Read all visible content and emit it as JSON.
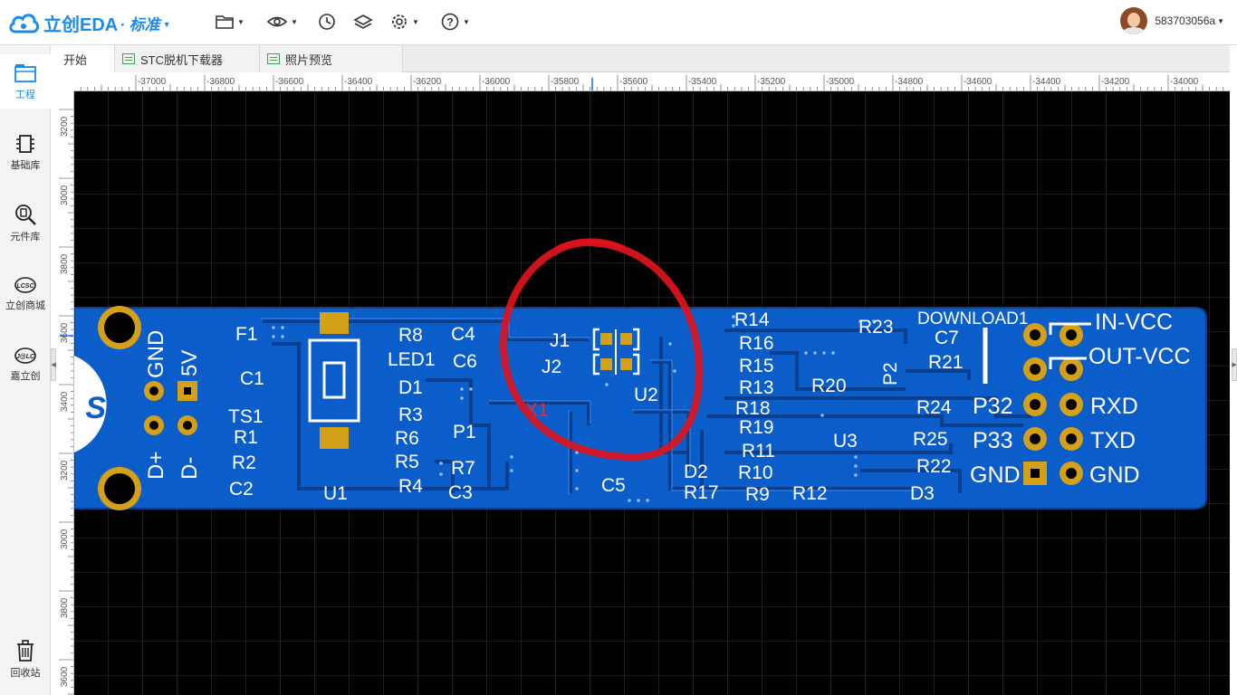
{
  "app": {
    "logo_text": "立创EDA",
    "edition": "标准"
  },
  "user": {
    "name": "583703056a"
  },
  "toolbar": {
    "items": [
      "folder-icon",
      "eye-icon",
      "history-icon",
      "layers-icon",
      "gear-icon",
      "help-icon"
    ]
  },
  "sidebar": {
    "items": [
      {
        "label": "工程",
        "icon": "project-icon",
        "active": true
      },
      {
        "label": "基础库",
        "icon": "chip-icon"
      },
      {
        "label": "元件库",
        "icon": "component-search-icon"
      },
      {
        "label": "立创商城",
        "icon": "lcsc-icon"
      },
      {
        "label": "嘉立创",
        "icon": "jlc-icon"
      },
      {
        "label": "回收站",
        "icon": "trash-icon"
      }
    ]
  },
  "tabs": [
    {
      "label": "开始"
    },
    {
      "label": "STC脱机下载器"
    },
    {
      "label": "照片预览"
    }
  ],
  "ruler": {
    "top_labels": [
      "-37000",
      "-36800",
      "-36600",
      "-36400",
      "-36200",
      "-36000",
      "-35800",
      "-35600",
      "-35400",
      "-35200",
      "-35000",
      "-34800",
      "-34600",
      "-34400",
      "-34200",
      "-34000"
    ],
    "left_labels": [
      "3200",
      "3000",
      "3800",
      "3600",
      "3400",
      "3200",
      "3000",
      "3800",
      "3600"
    ]
  },
  "pcb": {
    "logo_text": "SC",
    "left_pin_labels": [
      "GND",
      "5V",
      "D+",
      "D-"
    ],
    "designators": {
      "F1": "F1",
      "C1": "C1",
      "TS1": "TS1",
      "R1": "R1",
      "R2": "R2",
      "C2": "C2",
      "U1": "U1",
      "R8": "R8",
      "C4": "C4",
      "LED1": "LED1",
      "C6": "C6",
      "D1": "D1",
      "R3": "R3",
      "R6": "R6",
      "P1": "P1",
      "R5": "R5",
      "R7": "R7",
      "R4": "R4",
      "C3": "C3",
      "J1": "J1",
      "J2": "J2",
      "X1": "X1",
      "U2": "U2",
      "C5": "C5",
      "R14": "R14",
      "R16": "R16",
      "R15": "R15",
      "R13": "R13",
      "R18": "R18",
      "R19": "R19",
      "R11": "R11",
      "R10": "R10",
      "D2": "D2",
      "R17": "R17",
      "R9": "R9",
      "R12": "R12",
      "R20": "R20",
      "U3": "U3",
      "R23": "R23",
      "P2": "P2",
      "DOWNLOAD1": "DOWNLOAD1",
      "C7": "C7",
      "R21": "R21",
      "R24": "R24",
      "R25": "R25",
      "R22": "R22",
      "D3": "D3"
    },
    "right_left_labels": [
      "P32",
      "P33",
      "GND"
    ],
    "right_labels": [
      "IN-VCC",
      "OUT-VCC",
      "RXD",
      "TXD",
      "GND"
    ]
  },
  "colors": {
    "board": "#0b5ec9",
    "silk": "#ffffff",
    "pad": "#d4a017",
    "annotation": "#e0141e"
  }
}
